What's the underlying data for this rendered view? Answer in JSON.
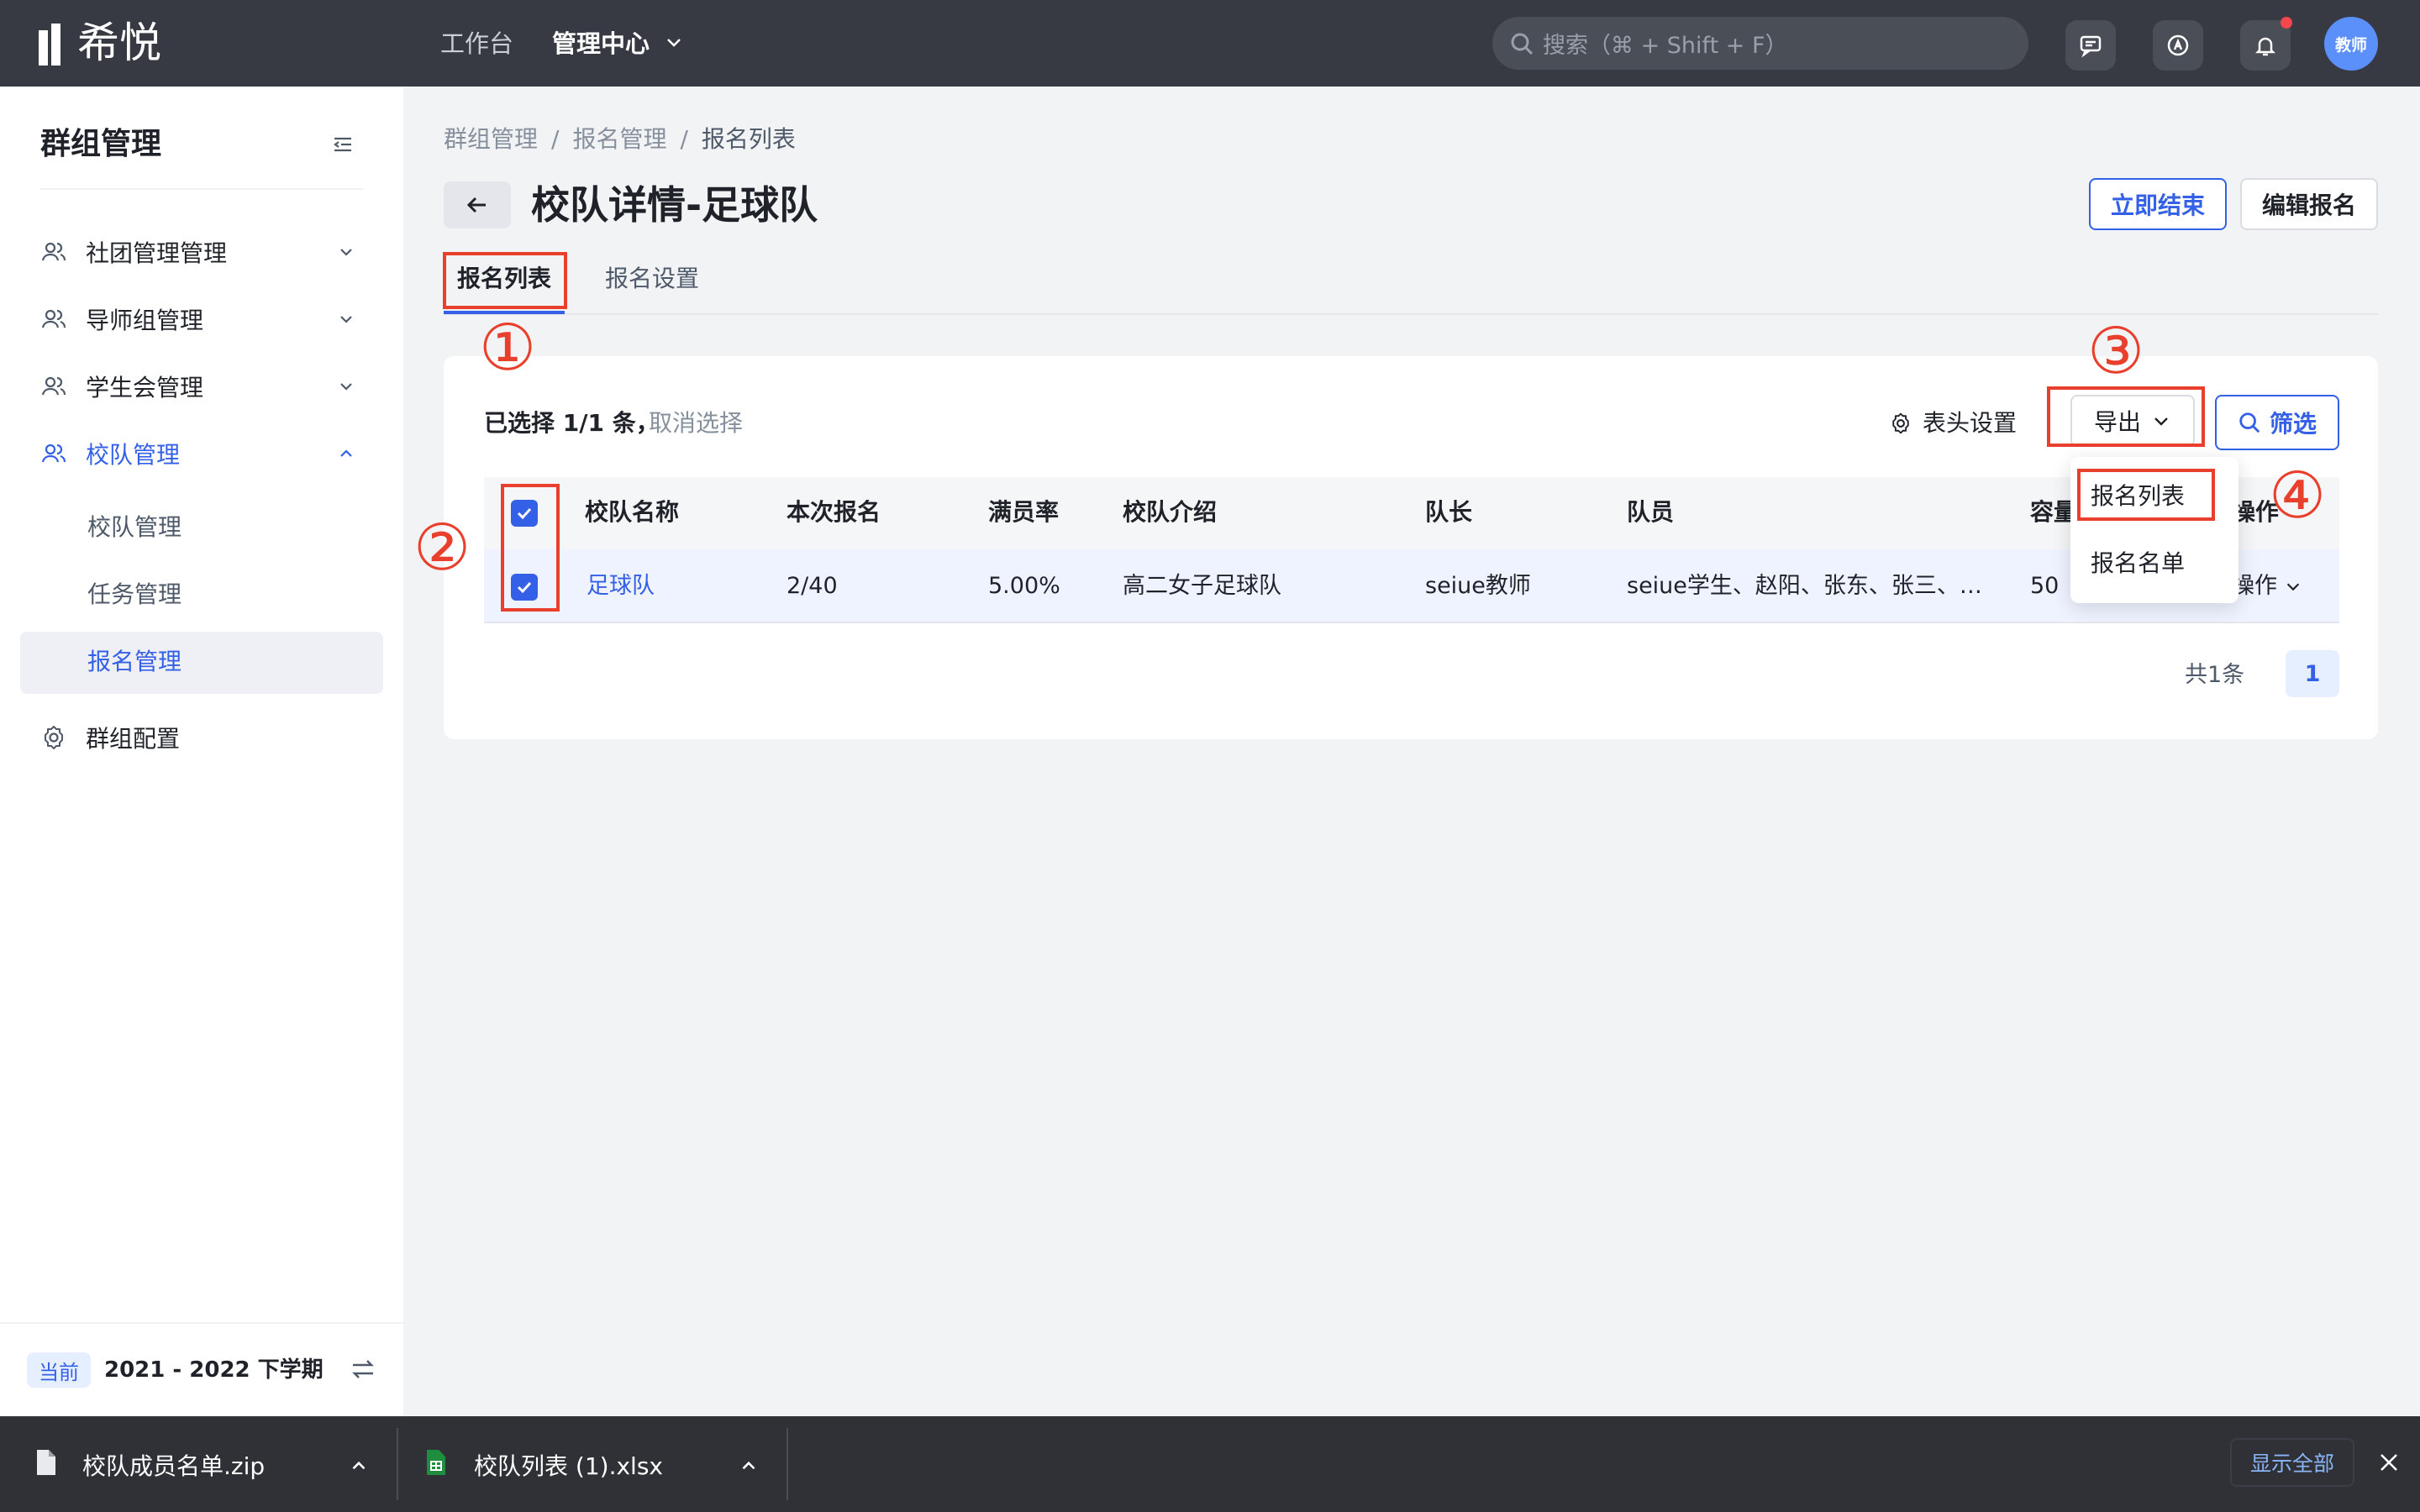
{
  "app": {
    "logo_text": "希悦"
  },
  "topnav": {
    "workbench": "工作台",
    "admin": "管理中心",
    "search_placeholder": "搜索（⌘ + Shift + F）",
    "avatar": "教师"
  },
  "sidebar": {
    "title": "群组管理",
    "items": [
      {
        "label": "社团管理管理"
      },
      {
        "label": "导师组管理"
      },
      {
        "label": "学生会管理"
      },
      {
        "label": "校队管理"
      },
      {
        "label": "群组配置"
      }
    ],
    "sub_items": [
      {
        "label": "校队管理"
      },
      {
        "label": "任务管理"
      },
      {
        "label": "报名管理"
      }
    ],
    "term_badge": "当前",
    "term": "2021 - 2022 下学期"
  },
  "breadcrumb": [
    "群组管理",
    "/",
    "报名管理",
    "/",
    "报名列表"
  ],
  "page": {
    "title": "校队详情-足球队",
    "btn_end": "立即结束",
    "btn_edit": "编辑报名"
  },
  "tabs": {
    "list": "报名列表",
    "setting": "报名设置"
  },
  "toolbar": {
    "selected": "已选择 1/1 条，",
    "cancel": "取消选择",
    "column_setting": "表头设置",
    "export": "导出",
    "filter": "筛选"
  },
  "table": {
    "headers": [
      "校队名称",
      "本次报名",
      "满员率",
      "校队介绍",
      "队长",
      "队员",
      "容量",
      "操作"
    ],
    "rows": [
      {
        "name": "足球队",
        "count": "2/40",
        "rate": "5.00%",
        "intro": "高二女子足球队",
        "captain": "seiue教师",
        "members": "seiue学生、赵阳、张东、张三、…",
        "capacity": "50",
        "action": "操作"
      }
    ]
  },
  "pagination": {
    "total": "共1条",
    "current": "1"
  },
  "export_menu": [
    "报名列表",
    "报名名单"
  ],
  "annotations": [
    "①",
    "②",
    "③",
    "④"
  ],
  "downloads": [
    {
      "name": "校队成员名单.zip"
    },
    {
      "name": "校队列表 (1).xlsx"
    }
  ],
  "download_bar": {
    "show_all": "显示全部"
  },
  "colors": {
    "accent": "#3460e8",
    "annotation": "#e8402c",
    "topbar": "#373a43"
  }
}
